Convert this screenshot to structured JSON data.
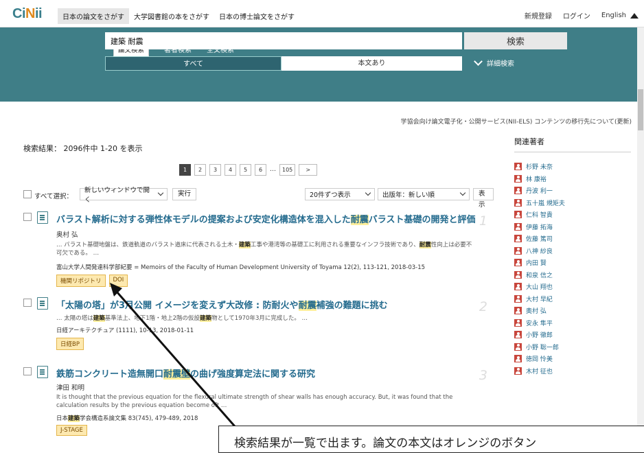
{
  "header": {
    "logo": "CiNii",
    "nav": [
      {
        "label": "日本の論文をさがす",
        "active": true
      },
      {
        "label": "大学図書館の本をさがす",
        "active": false
      },
      {
        "label": "日本の博士論文をさがす",
        "active": false
      }
    ],
    "right": {
      "register": "新規登録",
      "login": "ログイン",
      "lang": "English"
    }
  },
  "search": {
    "tabs": [
      "論文検索",
      "著者検索",
      "全文検索"
    ],
    "query": "建築 耐震",
    "button": "検索",
    "seg_all": "すべて",
    "seg_fulltext": "本文あり",
    "detail": "詳細検索",
    "notice": "学協会向け論文電子化・公開サービス(NII-ELS) コンテンツの移行先について(更新)"
  },
  "results_header": {
    "count": "検索結果： 2096件中 1-20 を表示",
    "pages": [
      "1",
      "2",
      "3",
      "4",
      "5",
      "6",
      "105"
    ],
    "ellipsis": "…",
    "select_all": "すべて選択：",
    "open_option": "新しいウィンドウで開く",
    "exec": "実行",
    "per_page": "20件ずつ表示",
    "sort": "出版年：新しい順",
    "show": "表示"
  },
  "results": [
    {
      "num": "1",
      "title_a": "バラスト解析に対する弾性体モデルの提案および安定化構造体を混入した",
      "title_hl": "耐震",
      "title_b": "バラスト基礎の開発と評価",
      "author": "奥村 弘",
      "snip_a": "… バラスト基礎地盤は、鉄道軌道のバラスト道床に代表される土木・",
      "snip_hl1": "建築",
      "snip_b": "工事や港湾等の基礎工に利用される重要なインフラ技術であり、",
      "snip_hl2": "耐震",
      "snip_c": "性向上は必要不可欠である。 …",
      "journal": "富山大学人間発達科学部紀要 = Memoirs of the Faculty of Human Development University of Toyama 12(2), 113-121, 2018-03-15",
      "tags": [
        "機関リポジトリ",
        "DOI"
      ]
    },
    {
      "num": "2",
      "title_a": "「太陽の塔」が3月公開 イメージを変えず大改修 : 防耐火や",
      "title_hl": "耐震",
      "title_b": "補強の難題に挑む",
      "snip_a": "… 太陽の塔は",
      "snip_hl1": "建築",
      "snip_b": "基準法上、地下1階・地上2階の仮設",
      "snip_hl2": "建築",
      "snip_c": "物として1970年3月に完成した。 …",
      "journal": "日経アーキテクチュア (1111), 10-13, 2018-01-11",
      "tags": [
        "日経BP"
      ]
    },
    {
      "num": "3",
      "title_a": "鉄筋コンクリート造無開口",
      "title_hl": "耐震壁",
      "title_b": "の曲げ強度算定法に関する研究",
      "author": "津田 和明",
      "snip": "It is thought that the previous equation for the flexural ultimate strength of shear walls has enough accuracy. But, it was found that the calculation results by the previous equation become oft …",
      "journal_a": "日本",
      "journal_hl": "建築",
      "journal_b": "学会構造系論文集 83(745), 479-489, 2018",
      "tags": [
        "J-STAGE"
      ]
    }
  ],
  "related": {
    "heading": "関連著者",
    "authors": [
      "杉野 未奈",
      "林 康裕",
      "丹波 利一",
      "五十嵐 規矩夫",
      "仁科 智貴",
      "伊藤 拓海",
      "佐藤 篤司",
      "八神 紗良",
      "内田 賢",
      "和泉 信之",
      "大山 翔也",
      "大村 早紀",
      "奥村 弘",
      "安永 隼平",
      "小野 徹郎",
      "小野 聡一郎",
      "徳岡 怜美",
      "木村 征也"
    ]
  },
  "annotation": "検索結果が一覧で出ます。論文の本文はオレンジのボタン"
}
